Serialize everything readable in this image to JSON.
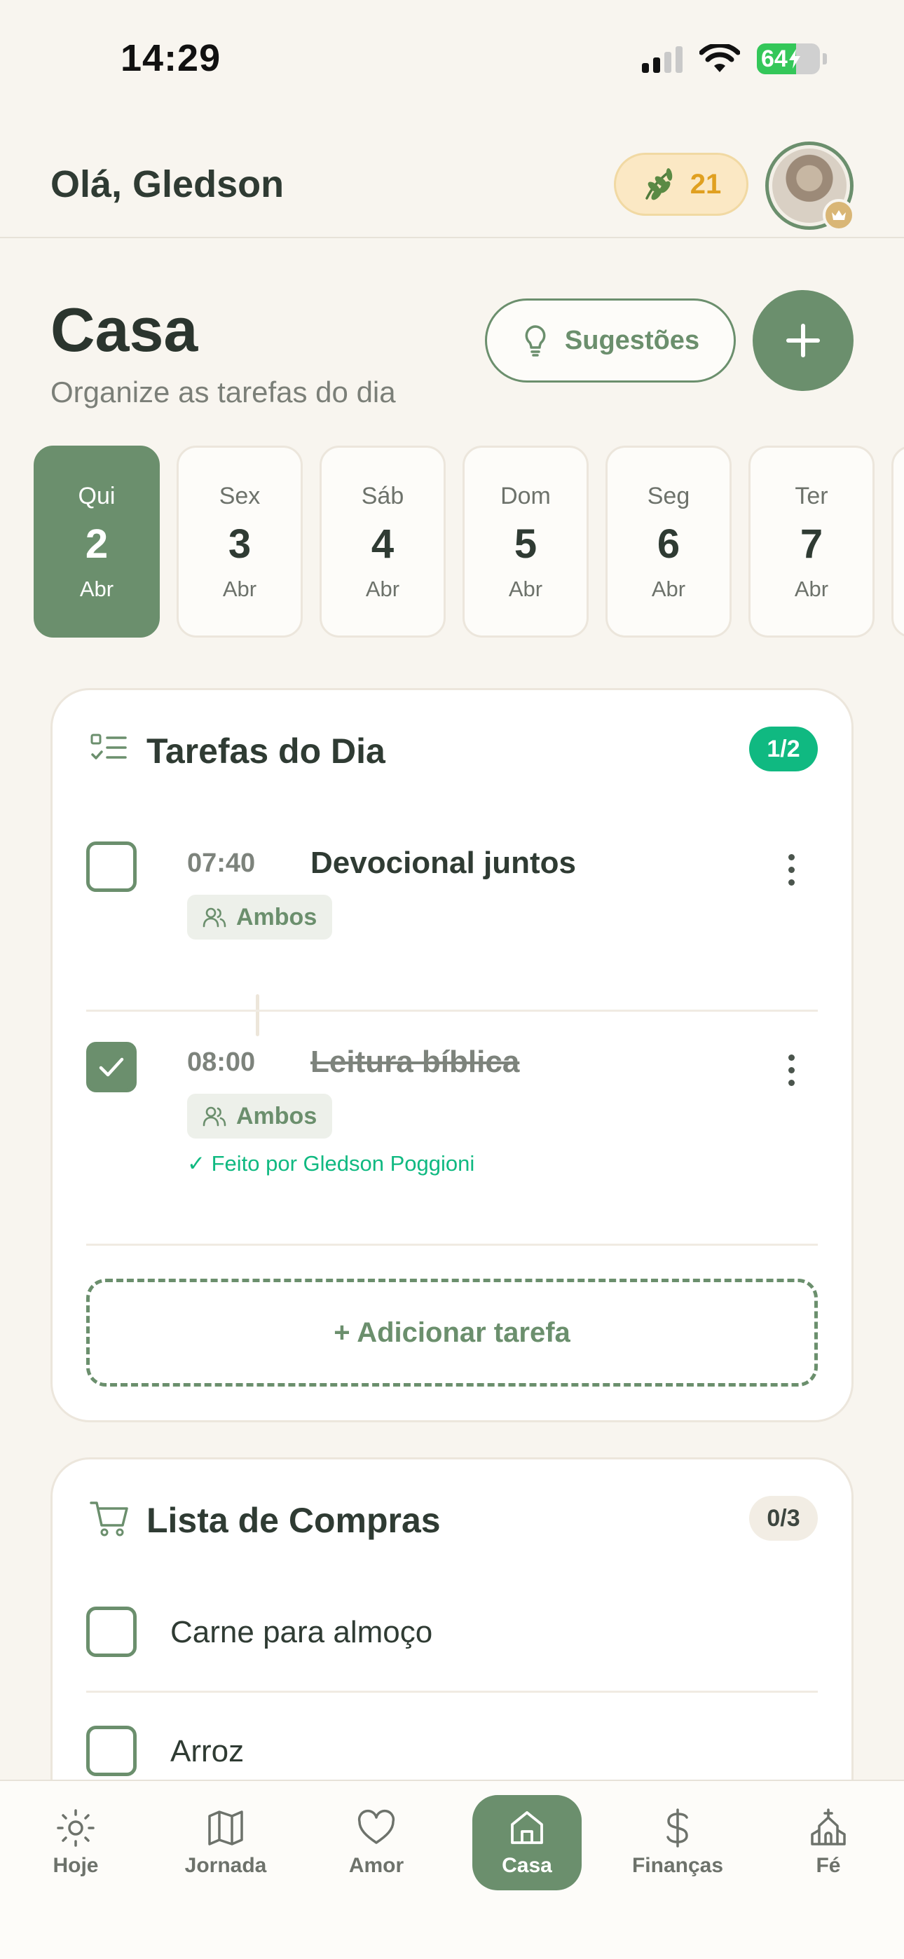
{
  "status_bar": {
    "time": "14:29",
    "battery": "64"
  },
  "header": {
    "greeting": "Olá, Gledson",
    "streak_count": "21"
  },
  "page": {
    "title": "Casa",
    "subtitle": "Organize as tarefas do dia",
    "suggestions_label": "Sugestões"
  },
  "days": [
    {
      "name": "Qui",
      "num": "2",
      "month": "Abr",
      "active": true
    },
    {
      "name": "Sex",
      "num": "3",
      "month": "Abr",
      "active": false
    },
    {
      "name": "Sáb",
      "num": "4",
      "month": "Abr",
      "active": false
    },
    {
      "name": "Dom",
      "num": "5",
      "month": "Abr",
      "active": false
    },
    {
      "name": "Seg",
      "num": "6",
      "month": "Abr",
      "active": false
    },
    {
      "name": "Ter",
      "num": "7",
      "month": "Abr",
      "active": false
    }
  ],
  "tasks_card": {
    "title": "Tarefas do Dia",
    "count": "1/2",
    "tasks": [
      {
        "time": "07:40",
        "name": "Devocional juntos",
        "assignee": "Ambos",
        "done": false,
        "done_by": ""
      },
      {
        "time": "08:00",
        "name": "Leitura bíblica",
        "assignee": "Ambos",
        "done": true,
        "done_by": "✓ Feito por Gledson Poggioni"
      }
    ],
    "add_label": "+ Adicionar tarefa"
  },
  "shopping_card": {
    "title": "Lista de Compras",
    "count": "0/3",
    "items": [
      {
        "label": "Carne para almoço",
        "checked": false
      },
      {
        "label": "Arroz",
        "checked": false
      }
    ]
  },
  "nav": [
    {
      "label": "Hoje",
      "icon": "sun-icon",
      "active": false
    },
    {
      "label": "Jornada",
      "icon": "map-icon",
      "active": false
    },
    {
      "label": "Amor",
      "icon": "heart-icon",
      "active": false
    },
    {
      "label": "Casa",
      "icon": "home-icon",
      "active": true
    },
    {
      "label": "Finanças",
      "icon": "dollar-icon",
      "active": false
    },
    {
      "label": "Fé",
      "icon": "church-icon",
      "active": false
    }
  ],
  "colors": {
    "accent": "#6b8f6d",
    "success": "#10b981",
    "background": "#f8f5ef",
    "streak_bg": "#fbe8c4",
    "streak_text": "#e0a020"
  }
}
